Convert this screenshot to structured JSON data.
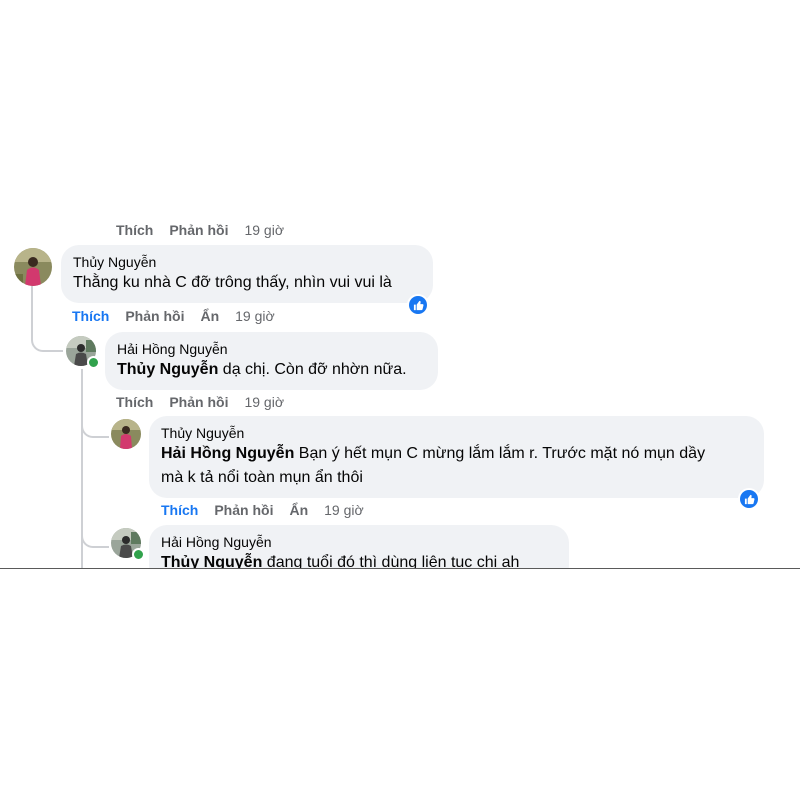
{
  "comments": [
    {
      "author": "Thủy Nguyễn",
      "text": "Thằng ku nhà C đỡ trông thấy, nhìn vui vui là",
      "actions": {
        "like": "Thích",
        "reply": "Phản hồi",
        "hide": "Ẩn",
        "time": "19 giờ"
      },
      "reaction": "like-reaction-icon"
    },
    {
      "author": "Hải Hồng Nguyễn",
      "mention": "Thủy Nguyễn",
      "text": " dạ chị. Còn đỡ nhờn nữa.",
      "actions": {
        "like": "Thích",
        "reply": "Phản hồi",
        "time": "19 giờ"
      }
    },
    {
      "author": "Thủy Nguyễn",
      "mention": "Hải Hồng Nguyễn",
      "text_line1": " Bạn ý hết mụn C mừng lắm lắm r. Trước mặt nó mụn dầy",
      "text_line2": "mà k tả nổi toàn mụn ẩn thôi",
      "actions": {
        "like": "Thích",
        "reply": "Phản hồi",
        "hide": "Ẩn",
        "time": "19 giờ"
      },
      "reaction": "like-reaction-icon"
    },
    {
      "author": "Hải Hồng Nguyễn",
      "mention": "Thủy Nguyễn",
      "text": " đang tuổi đó thì dùng liên tục chị ah"
    }
  ],
  "previous_actions": {
    "like": "Thích",
    "reply": "Phản hồi",
    "time": "19 giờ"
  },
  "colors": {
    "accent": "#1877f2",
    "bubble": "#f0f2f5",
    "secondary_text": "#65676b",
    "online": "#31a24c"
  }
}
